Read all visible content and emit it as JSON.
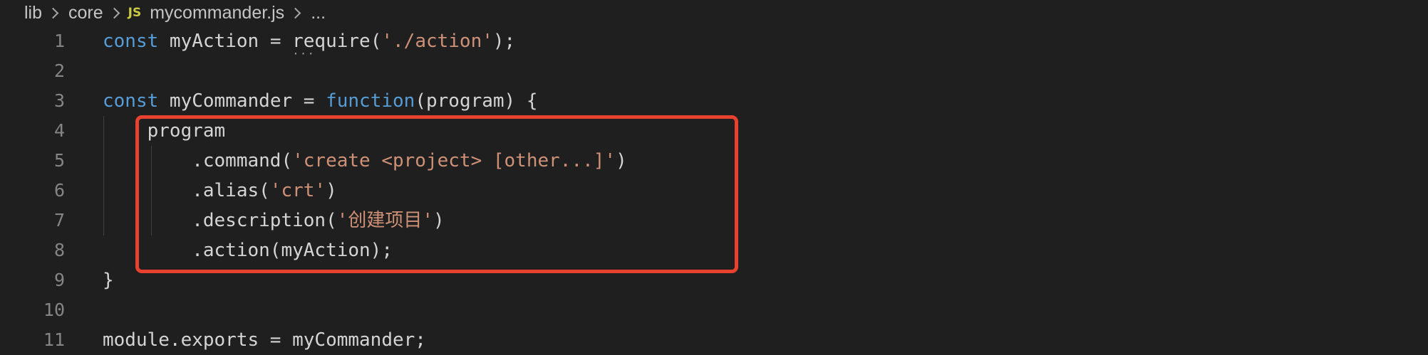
{
  "breadcrumb": {
    "items": [
      "lib",
      "core"
    ],
    "file_icon": "JS",
    "file_name": "mycommander.js",
    "more": "..."
  },
  "editor": {
    "lines": [
      {
        "num": "1",
        "tokens": [
          {
            "t": "const",
            "c": "kw"
          },
          {
            "t": " myAction = ",
            "c": "id"
          },
          {
            "t": "require",
            "c": "req"
          },
          {
            "t": "(",
            "c": "id"
          },
          {
            "t": "'./action'",
            "c": "str"
          },
          {
            "t": ");",
            "c": "id"
          }
        ]
      },
      {
        "num": "2",
        "tokens": []
      },
      {
        "num": "3",
        "tokens": [
          {
            "t": "const",
            "c": "kw"
          },
          {
            "t": " myCommander = ",
            "c": "id"
          },
          {
            "t": "function",
            "c": "kw"
          },
          {
            "t": "(program) {",
            "c": "id"
          }
        ]
      },
      {
        "num": "4",
        "tokens": [
          {
            "t": "    program",
            "c": "id"
          }
        ]
      },
      {
        "num": "5",
        "tokens": [
          {
            "t": "        .command(",
            "c": "id"
          },
          {
            "t": "'create <project> [other...]'",
            "c": "str"
          },
          {
            "t": ")",
            "c": "id"
          }
        ]
      },
      {
        "num": "6",
        "tokens": [
          {
            "t": "        .alias(",
            "c": "id"
          },
          {
            "t": "'crt'",
            "c": "str"
          },
          {
            "t": ")",
            "c": "id"
          }
        ]
      },
      {
        "num": "7",
        "tokens": [
          {
            "t": "        .description(",
            "c": "id"
          },
          {
            "t": "'创建项目'",
            "c": "str"
          },
          {
            "t": ")",
            "c": "id"
          }
        ]
      },
      {
        "num": "8",
        "tokens": [
          {
            "t": "        .action(myAction);",
            "c": "id"
          }
        ]
      },
      {
        "num": "9",
        "tokens": [
          {
            "t": "}",
            "c": "id"
          }
        ]
      },
      {
        "num": "10",
        "tokens": []
      },
      {
        "num": "11",
        "tokens": [
          {
            "t": "module.exports = myCommander;",
            "c": "id"
          }
        ]
      }
    ]
  },
  "colors": {
    "background": "#1f1f1f",
    "keyword": "#569cd6",
    "string": "#ce9178",
    "identifier": "#d4d4d4",
    "line_number": "#858585",
    "highlight_border": "#e8412f"
  }
}
